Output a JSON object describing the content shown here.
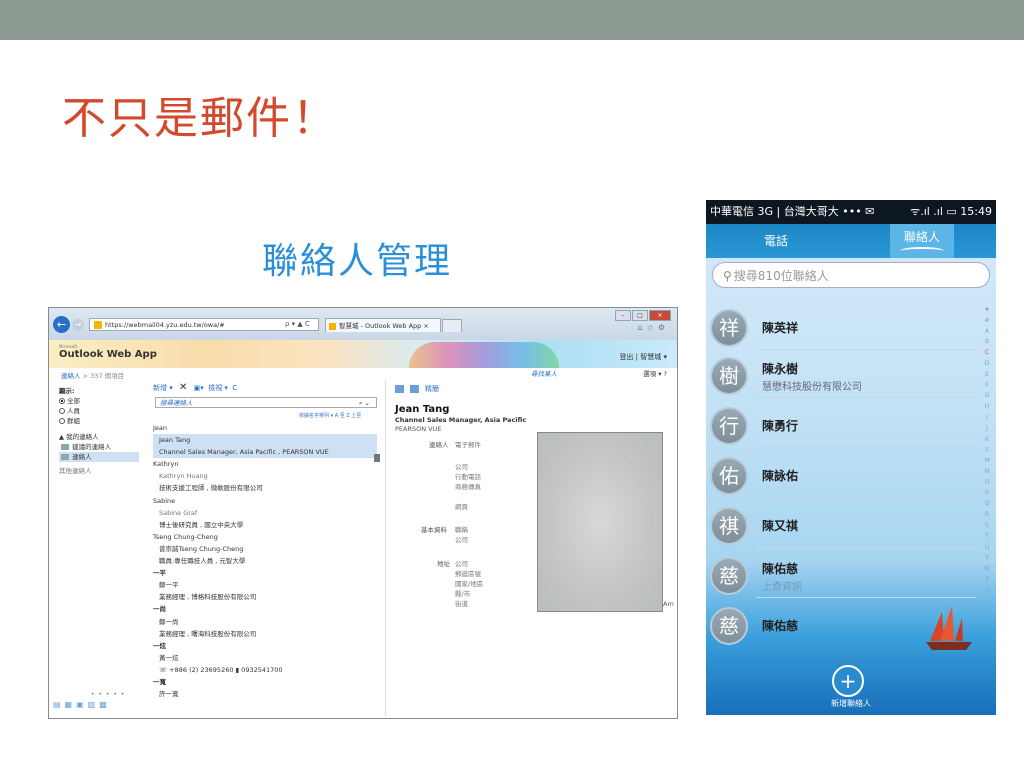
{
  "slide": {
    "title": "不只是郵件！",
    "subtitle": "聯絡人管理"
  },
  "owa": {
    "browser": {
      "url": "https://webmail04.yzu.edu.tw/owa/#",
      "url_controls": "ρ ▾ ▲ C",
      "tab_title": "智慧城 - Outlook Web App",
      "tab_close": "×"
    },
    "app_name": "Outlook Web App",
    "app_brand_small": "Microsoft",
    "signout": "登出 | 智慧城 ▾",
    "breadcrumb": {
      "root": "連絡人",
      "sep": ">",
      "count": "337 個項目"
    },
    "find_someone": "尋找某人",
    "options": "選項 ▾",
    "help": "?",
    "leftnav": {
      "show_label": "顯示:",
      "filters": [
        "全部",
        "人員",
        "群組"
      ],
      "my_contacts": "▲ 我的連絡人",
      "folders": [
        "建議的連絡人",
        "連絡人"
      ],
      "other": "其他連絡人"
    },
    "toolbar": {
      "new": "新增 ▾",
      "delete": "✕",
      "move": "▾",
      "view": "檢視 ▾",
      "refresh": "C"
    },
    "search_placeholder": "搜尋連絡人",
    "search_icon": "search-icon",
    "sort_label": "依據名字排列 ▾  A 至 Z 上至",
    "contacts": [
      {
        "header": "Jean",
        "name": "Jean Tang",
        "detail": "Channel Sales Manager, Asia Pacific , PEARSON VUE"
      },
      {
        "header": "Kathryn",
        "name": "Kathryn Huang",
        "detail": "技術支援工程師 , 微軟股份有限公司"
      },
      {
        "header": "Sabine",
        "name": "Sabine Graf",
        "detail": "博士後研究員 , 國立中央大學"
      },
      {
        "header": "Tseng Chung-Cheng",
        "name": "曾崇誠Tseng Chung-Cheng",
        "detail": "職員:專任職技人員 , 元智大學"
      },
      {
        "header": "一平",
        "name": "鄭一平",
        "detail": "業務經理 , 博格科技股份有限公司"
      },
      {
        "header": "一尚",
        "name": "鄭一尚",
        "detail": "業務經理 , 曙海科技股份有限公司"
      },
      {
        "header": "一炫",
        "name": "黃一炫",
        "detail": "☏ +886 (2) 23695260   ▮ 0932541700"
      },
      {
        "header": "一寬",
        "name": "許一寬",
        "detail": ""
      }
    ],
    "reading": {
      "tools": "精簡",
      "name": "Jean Tang",
      "title": "Channel Sales Manager, Asia Pacific",
      "company": "PEARSON VUE",
      "contact_label": "連絡人",
      "contact_fields": [
        "電子郵件",
        "",
        "公司",
        "行動電話",
        "商務傳真",
        "",
        "網頁"
      ],
      "info_label": "基本資料",
      "info_fields": [
        "職稱",
        "公司"
      ],
      "address_label": "地址",
      "address_fields": [
        "公司",
        "郵遞區號",
        "國家/地區",
        "縣/市",
        "街道"
      ],
      "cutoff": "Am"
    }
  },
  "phone": {
    "status_left": "中華電信 3G | 台灣大哥大 ••• ✉",
    "status_right": "ᯤ.ıl .ıl ▭ 15:49",
    "tabs": [
      "電話",
      "聯絡人"
    ],
    "search_placeholder": "搜尋810位聯絡人",
    "contacts": [
      {
        "avatar": "祥",
        "name": "陳英祥",
        "sub": ""
      },
      {
        "avatar": "樹",
        "name": "陳永樹",
        "sub": "慧懋科技股份有限公司"
      },
      {
        "avatar": "行",
        "name": "陳勇行",
        "sub": ""
      },
      {
        "avatar": "佑",
        "name": "陳詠佑",
        "sub": ""
      },
      {
        "avatar": "祺",
        "name": "陳又祺",
        "sub": ""
      },
      {
        "avatar": "慈",
        "name": "陳佑慈",
        "sub": "上奇資訊"
      },
      {
        "avatar": "慈",
        "name": "陳佑慈",
        "sub": ""
      }
    ],
    "index_letters": [
      "★",
      "#",
      "A",
      "B",
      "C",
      "D",
      "E",
      "F",
      "G",
      "H",
      "I",
      "J",
      "K",
      "L",
      "M",
      "N",
      "O",
      "P",
      "Q",
      "R",
      "S",
      "T",
      "U",
      "V",
      "W",
      "X",
      "Y"
    ],
    "add_label": "新增聯絡人",
    "add_icon": "plus-icon"
  }
}
